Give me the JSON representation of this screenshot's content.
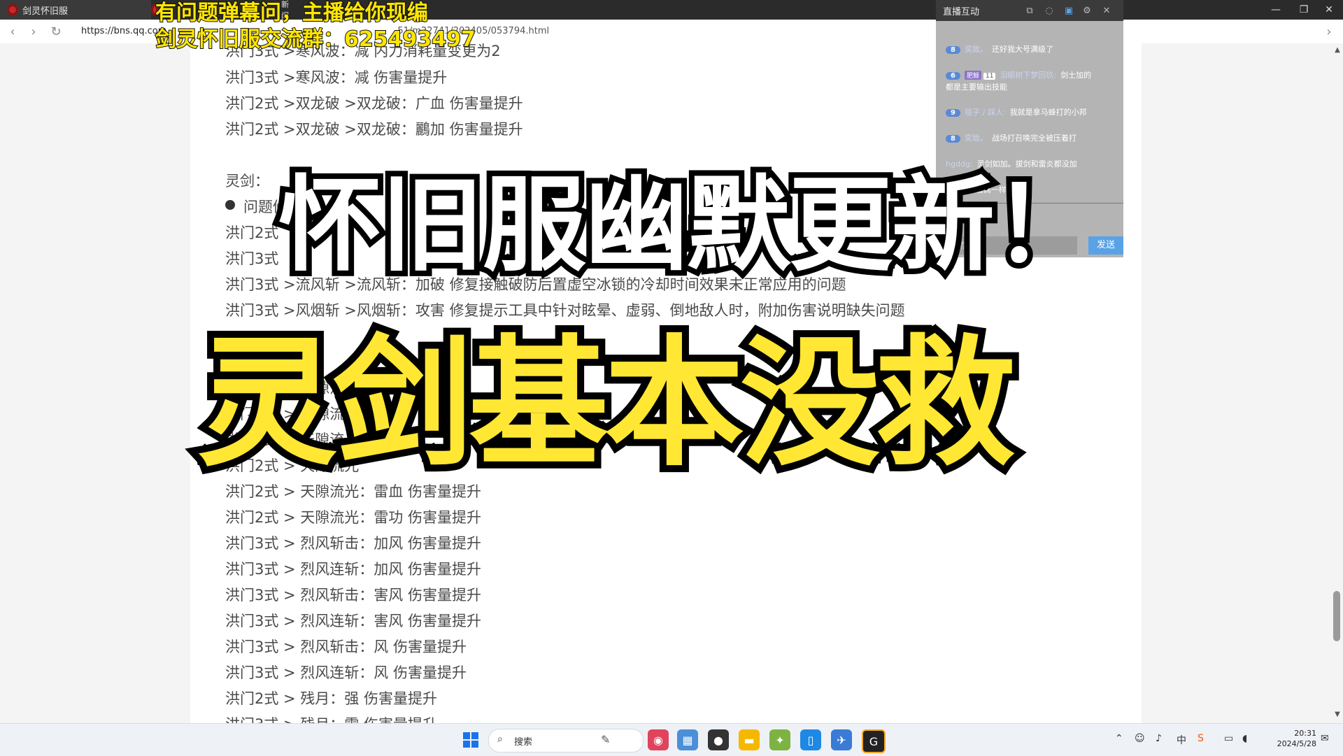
{
  "browser": {
    "tabs": [
      {
        "label": "剑灵怀旧服"
      },
      {
        "label": "新闻"
      }
    ],
    "url": "https://bns.qq.com",
    "url_tail": "51/m22741/202405/053794.html"
  },
  "article": {
    "lines": [
      "洪门3式 >寒风波：减 内力消耗量变更为2",
      "洪门3式 >寒风波：减 伤害量提升",
      "洪门2式 >双龙破 >双龙破：广血 伤害量提升",
      "洪门2式 >双龙破 >双龙破：鸝加 伤害量提升",
      "灵剑：",
      "问题修",
      "洪门2式",
      "洪门3式",
      "洪门3式 >流风斩 >流风斩：加破 修复接触破防后置虚空冰锁的冷却时间效果未正常应用的问题",
      "洪门3式 >风烟斩 >风烟斩：攻害 修复提示工具中针对眩晕、虚弱、倒地敌人时，附加伤害说明缺失问题",
      "平衡调整",
      "洪门2式 > 天隙流光",
      "洪门2式 > 天隙流光",
      "洪门2式 > 天隙流光",
      "洪门2式 > 天隙流光",
      "洪门2式 > 天隙流光：雷血 伤害量提升",
      "洪门2式 > 天隙流光：雷功 伤害量提升",
      "洪门3式 > 烈风斩击：加风 伤害量提升",
      "洪门3式 > 烈风连斩：加风 伤害量提升",
      "洪门3式 > 烈风斩击：害风 伤害量提升",
      "洪门3式 > 烈风连斩：害风 伤害量提升",
      "洪门3式 > 烈风斩击：风 伤害量提升",
      "洪门3式 > 烈风连斩：风 伤害量提升",
      "洪门2式 > 残月：强 伤害量提升",
      "洪门3式 > 残月：雷 伤害量提升"
    ]
  },
  "overlay": {
    "top_caption_1": "有问题弹幕问，主播给你现编",
    "top_caption_2": "剑灵怀旧服交流群：625493497",
    "headline_1": "怀旧服幽默更新！",
    "headline_2": "灵剑基本没救"
  },
  "live_panel": {
    "title": "直播互动",
    "messages": [
      {
        "level": "8",
        "user": "奕致。",
        "text": "还好我大号满级了"
      },
      {
        "level": "6",
        "fans": "肥鲸",
        "fans_level": "11",
        "user": "泪眼树下梦回玖:",
        "text": "剑士加的"
      },
      {
        "text2": "都是主要输出技能"
      },
      {
        "level": "9",
        "user": "毯子丿踩人:",
        "text": "我就是拿马蜂打的小邦"
      },
      {
        "level": "8",
        "user": "奕致。",
        "text": "战场打召唤完全被压着打"
      },
      {
        "user": "hgddg:",
        "text": "灵剑如加。拔剑和雷炎都没加"
      },
      {
        "user": "先生:",
        "text": "暴击高一样的"
      }
    ],
    "hint": "和主播聊了",
    "input_placeholder": "说点什么",
    "send_label": "发送"
  },
  "taskbar": {
    "search_label": "搜索",
    "time": "20:31",
    "date": "2024/5/28",
    "ime": "中"
  }
}
